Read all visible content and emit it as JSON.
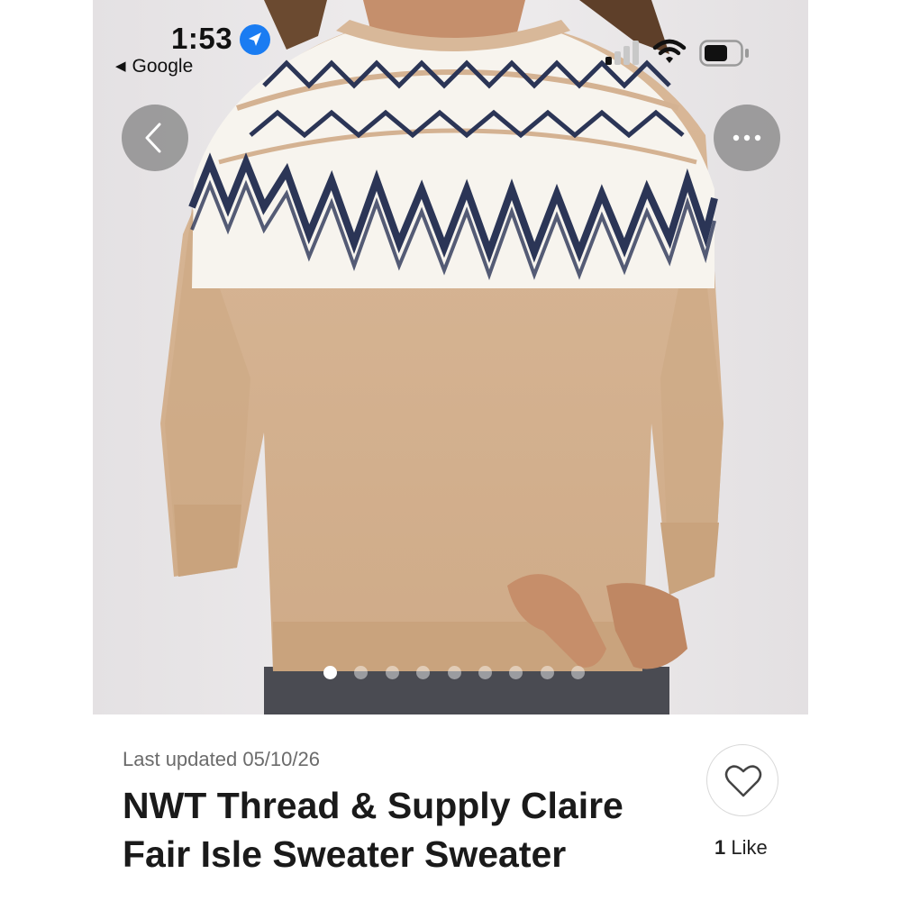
{
  "status_bar": {
    "time": "1:53",
    "back_app_label": "Google",
    "icons": [
      "location-arrow-icon",
      "cellular-signal-icon",
      "wifi-icon",
      "battery-icon"
    ]
  },
  "photo_carousel": {
    "total_photos": 9,
    "current_index": 1
  },
  "listing": {
    "last_updated": "Last updated 05/10/26",
    "title_line1": "NWT Thread & Supply Claire",
    "title_line2": "Fair Isle Sweater Sweater",
    "like_count": "1",
    "like_label": "Like"
  },
  "colors": {
    "sweater_tan": "#d4b292",
    "pattern_navy": "#2b3556",
    "pattern_cream": "#f7f4ee",
    "location_blue": "#1a7cf2"
  }
}
